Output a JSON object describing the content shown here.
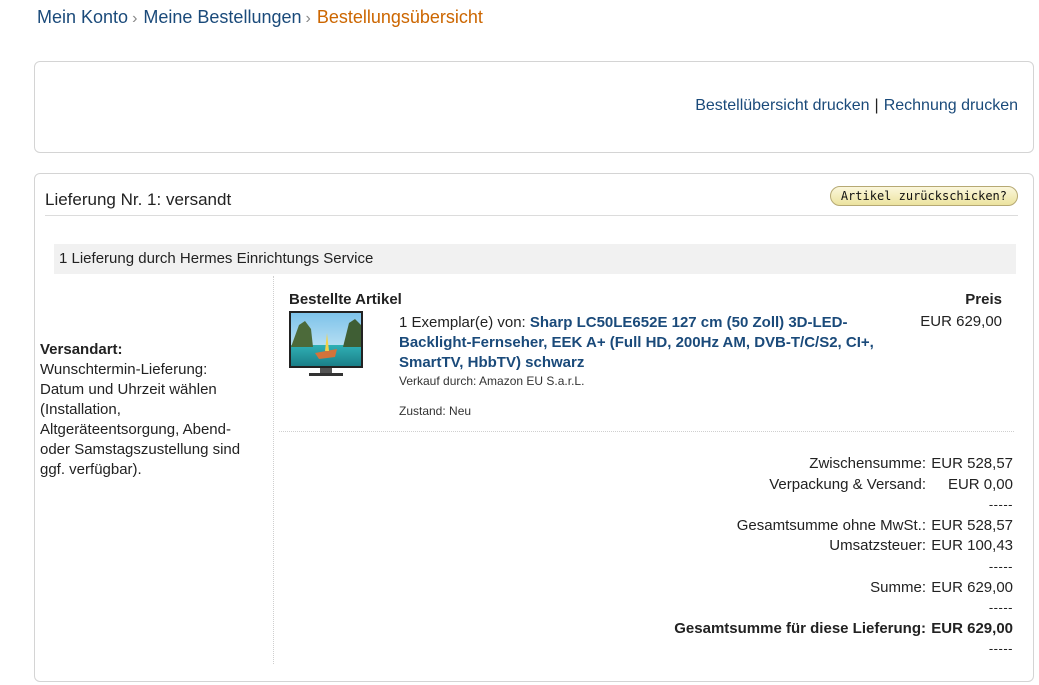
{
  "breadcrumb": {
    "items": [
      "Mein Konto",
      "Meine Bestellungen"
    ],
    "current": "Bestellungsübersicht",
    "separator": "›"
  },
  "print": {
    "order_summary": "Bestellübersicht drucken",
    "separator": "|",
    "invoice": "Rechnung drucken"
  },
  "shipment": {
    "title": "Lieferung Nr. 1: versandt",
    "return_button": "Artikel zurückschicken?",
    "carrier": "1 Lieferung durch Hermes Einrichtungs Service",
    "method_label": "Versandart:",
    "method_text": "Wunschtermin-Lieferung: Datum und Uhrzeit wählen (Installation, Altgeräteentsorgung, Abend- oder Samstagszustellung sind ggf. verfügbar).",
    "items_header": "Bestellte Artikel",
    "price_header": "Preis",
    "item": {
      "qty_prefix": "1 Exemplar(e) von:",
      "title": "Sharp LC50LE652E 127 cm (50 Zoll) 3D-LED-Backlight-Fernseher, EEK A+ (Full HD, 200Hz AM, DVB-T/C/S2, CI+, SmartTV, HbbTV) schwarz",
      "seller": "Verkauf durch: Amazon EU S.a.r.L.",
      "condition": "Zustand: Neu",
      "price": "EUR 629,00",
      "thumbnail_icon": "tv-thumbnail-icon"
    },
    "totals": [
      {
        "label": "Zwischensumme:",
        "value": "EUR 528,57"
      },
      {
        "label": "Verpackung & Versand:",
        "value": "EUR 0,00"
      },
      {
        "label": "",
        "value": "-----"
      },
      {
        "label": "Gesamtsumme ohne MwSt.:",
        "value": "EUR 528,57"
      },
      {
        "label": "Umsatzsteuer:",
        "value": "EUR 100,43"
      },
      {
        "label": "",
        "value": "-----"
      },
      {
        "label": "Summe:",
        "value": "EUR 629,00"
      },
      {
        "label": "",
        "value": "-----"
      },
      {
        "label": "Gesamtsumme für diese Lieferung:",
        "value": "EUR 629,00"
      },
      {
        "label": "",
        "value": "-----"
      }
    ]
  },
  "colors": {
    "link": "#1a4a7a",
    "breadcrumb_current": "#cc6600",
    "button_bg": "#ece39f"
  }
}
